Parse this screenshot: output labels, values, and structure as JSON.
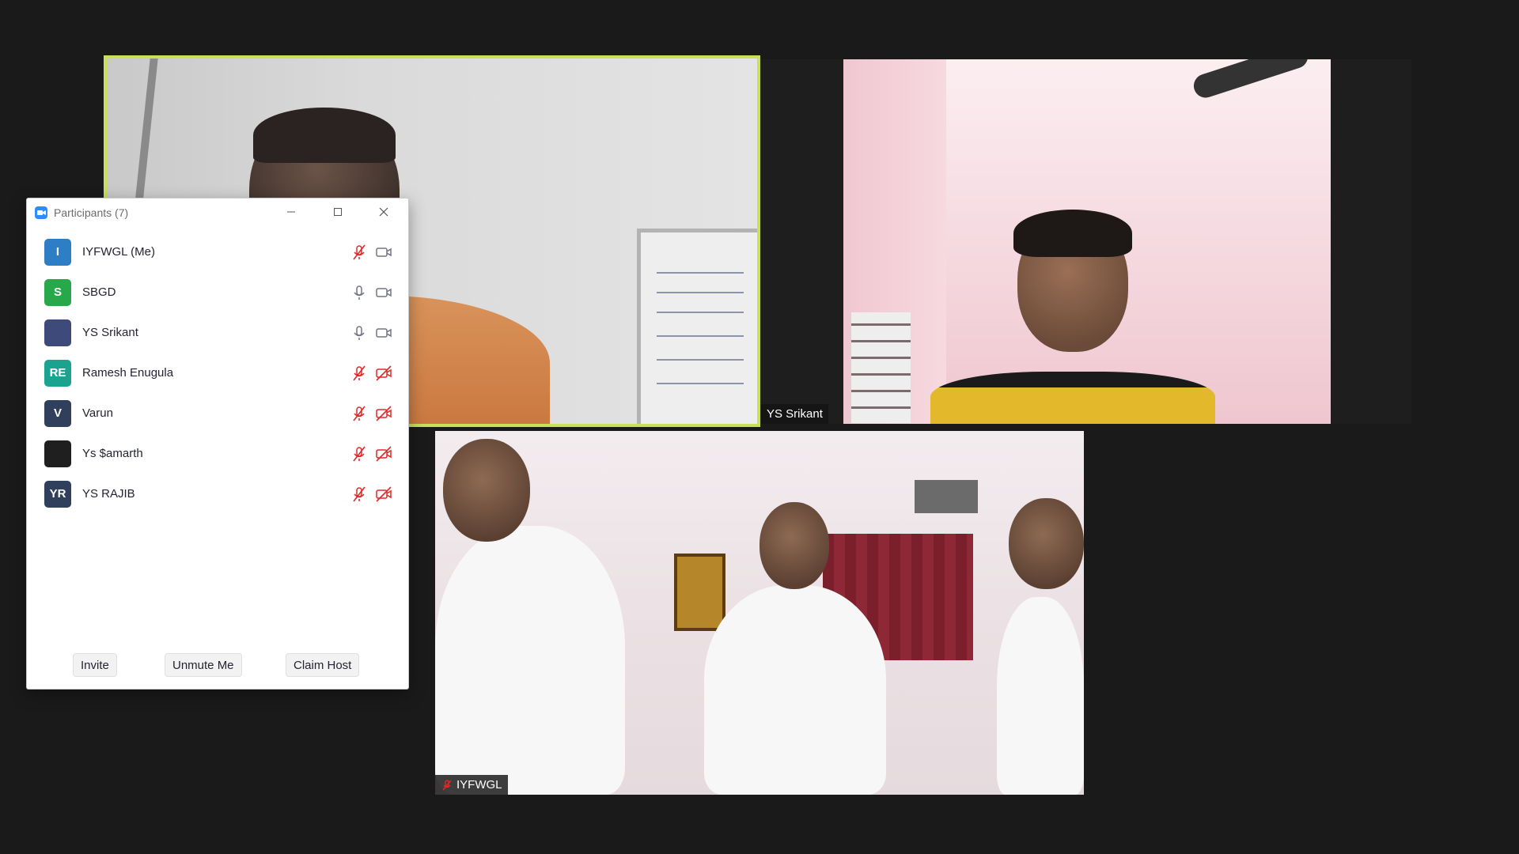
{
  "panel": {
    "title": "Participants (7)",
    "participants": [
      {
        "name": "IYFWGL (Me)",
        "initials": "I",
        "avatar_color": "#2d7ec4",
        "mic": "muted",
        "video": "on"
      },
      {
        "name": "SBGD",
        "initials": "S",
        "avatar_color": "#27a84a",
        "mic": "unmuted",
        "video": "on"
      },
      {
        "name": "YS Srikant",
        "initials": "",
        "avatar_color": "#3d4a7a",
        "mic": "unmuted",
        "video": "on"
      },
      {
        "name": "Ramesh Enugula",
        "initials": "RE",
        "avatar_color": "#1aa38f",
        "mic": "muted",
        "video": "off"
      },
      {
        "name": "Varun",
        "initials": "V",
        "avatar_color": "#2f3f5c",
        "mic": "muted",
        "video": "off"
      },
      {
        "name": "Ys $amarth",
        "initials": "",
        "avatar_color": "#1f1f1f",
        "mic": "muted",
        "video": "off"
      },
      {
        "name": "YS RAJIB",
        "initials": "YR",
        "avatar_color": "#2f3f5c",
        "mic": "muted",
        "video": "off"
      }
    ],
    "buttons": {
      "invite": "Invite",
      "unmute": "Unmute Me",
      "claim_host": "Claim Host"
    }
  },
  "tiles": {
    "top_right_name": "YS Srikant",
    "bottom_name": "IYFWGL"
  },
  "colors": {
    "active_speaker_border": "#c8e05a",
    "muted_red": "#e02828",
    "background": "#1a1a1a"
  }
}
